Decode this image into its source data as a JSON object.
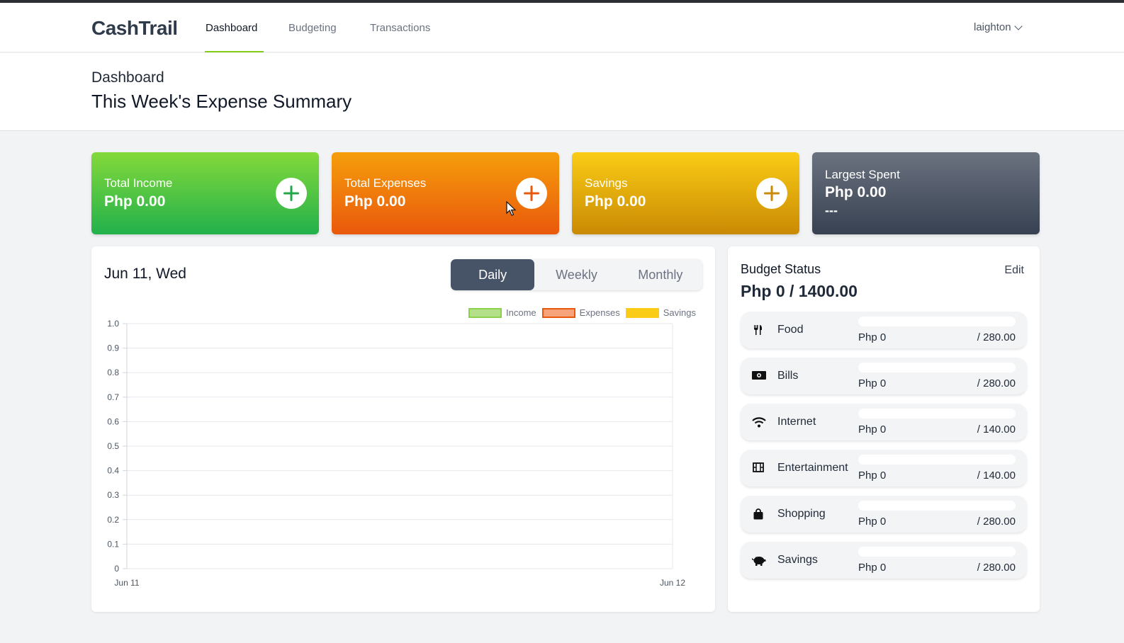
{
  "app": {
    "logo": "CashTrail"
  },
  "nav": {
    "links": [
      "Dashboard",
      "Budgeting",
      "Transactions"
    ],
    "active": "Dashboard",
    "user": "laighton"
  },
  "header": {
    "breadcrumb": "Dashboard",
    "title": "This Week's Expense Summary"
  },
  "cards": {
    "income": {
      "label": "Total Income",
      "amount": "Php 0.00"
    },
    "expenses": {
      "label": "Total Expenses",
      "amount": "Php 0.00"
    },
    "savings": {
      "label": "Savings",
      "amount": "Php 0.00"
    },
    "largest": {
      "label": "Largest Spent",
      "amount": "Php 0.00",
      "detail": "---"
    }
  },
  "chart_panel": {
    "date": "Jun 11, Wed",
    "segments": [
      "Daily",
      "Weekly",
      "Monthly"
    ],
    "selected_segment": "Daily"
  },
  "chart_data": {
    "type": "bar",
    "categories": [
      "Jun 11",
      "Jun 12"
    ],
    "series": [
      {
        "name": "Income",
        "values": [
          0,
          0
        ],
        "color": "#b4e08a",
        "stroke": "#8bd14b"
      },
      {
        "name": "Expenses",
        "values": [
          0,
          0
        ],
        "color": "#f7a47c",
        "stroke": "#ea580c"
      },
      {
        "name": "Savings",
        "values": [
          0,
          0
        ],
        "color": "#facc15",
        "stroke": "#facc15"
      }
    ],
    "ylim": [
      0,
      1.0
    ],
    "yticks": [
      "0",
      "0.1",
      "0.2",
      "0.3",
      "0.4",
      "0.5",
      "0.6",
      "0.7",
      "0.8",
      "0.9",
      "1.0"
    ],
    "xticks": [
      "Jun 11",
      "Jun 12"
    ],
    "grid": true,
    "legend_position": "top-right"
  },
  "budget": {
    "title": "Budget Status",
    "total": "Php 0 / 1400.00",
    "edit_label": "Edit",
    "items": [
      {
        "name": "Food",
        "icon": "utensils-icon",
        "spent": "Php 0",
        "limit": "/ 280.00",
        "progress": 0
      },
      {
        "name": "Bills",
        "icon": "money-bill-icon",
        "spent": "Php 0",
        "limit": "/ 280.00",
        "progress": 0
      },
      {
        "name": "Internet",
        "icon": "wifi-icon",
        "spent": "Php 0",
        "limit": "/ 140.00",
        "progress": 0
      },
      {
        "name": "Entertainment",
        "icon": "film-icon",
        "spent": "Php 0",
        "limit": "/ 140.00",
        "progress": 0
      },
      {
        "name": "Shopping",
        "icon": "shopping-bag-icon",
        "spent": "Php 0",
        "limit": "/ 280.00",
        "progress": 0
      },
      {
        "name": "Savings",
        "icon": "piggy-bank-icon",
        "spent": "Php 0",
        "limit": "/ 280.00",
        "progress": 0
      }
    ]
  },
  "colors": {
    "accent": "#84cc16",
    "income": "#22b14c",
    "expenses": "#ea580c",
    "savings": "#ca8a04",
    "largest": "#374151"
  }
}
